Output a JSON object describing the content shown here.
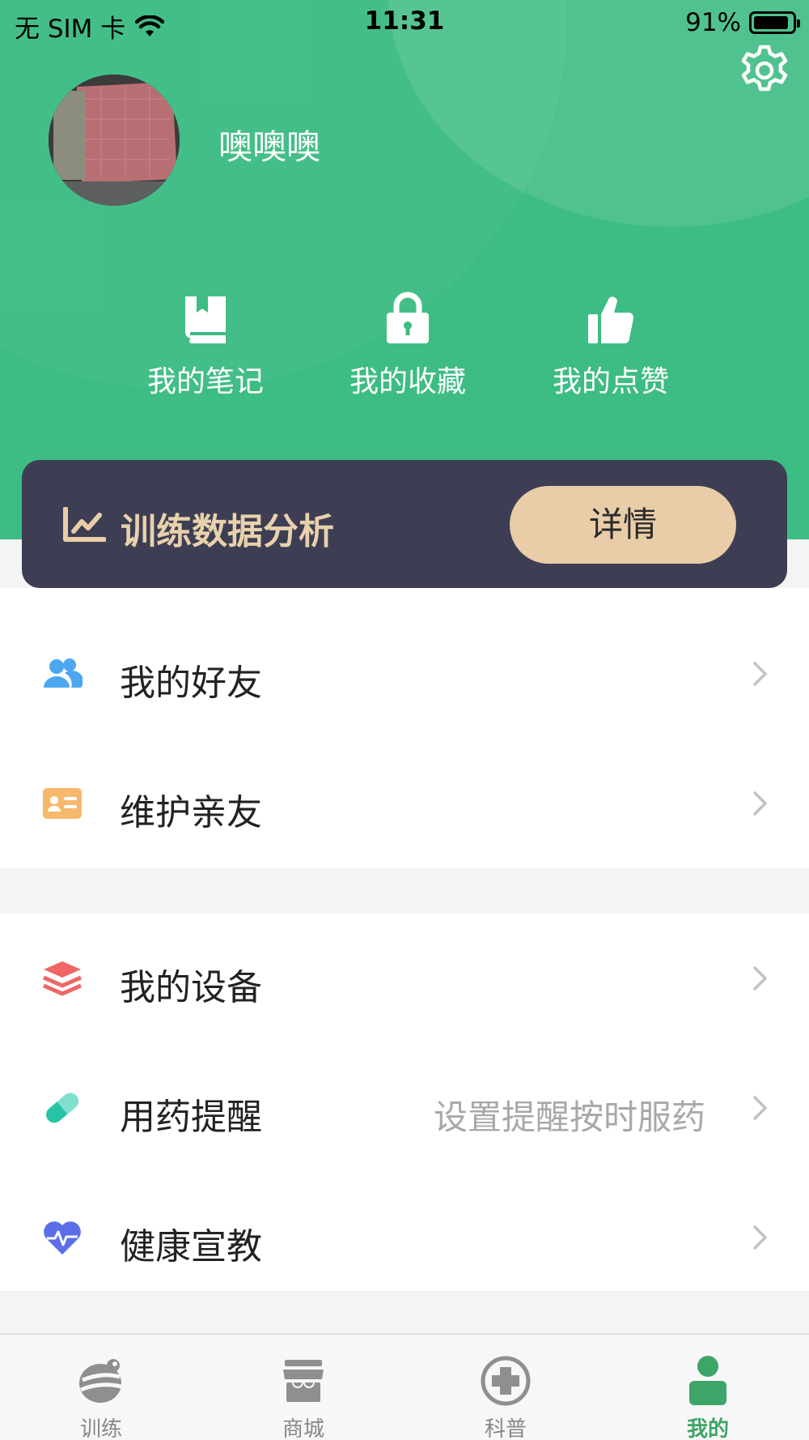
{
  "status_bar": {
    "carrier": "无 SIM 卡",
    "time": "11:31",
    "battery_percent": "91%",
    "battery_level": 0.91
  },
  "profile": {
    "username": "噢噢噢"
  },
  "quick_actions": [
    {
      "label": "我的笔记",
      "icon": "book-icon"
    },
    {
      "label": "我的收藏",
      "icon": "lock-icon"
    },
    {
      "label": "我的点赞",
      "icon": "thumbs-up-icon"
    }
  ],
  "banner": {
    "title": "训练数据分析",
    "button_label": "详情",
    "icon": "line-chart-icon"
  },
  "menu_groups": [
    [
      {
        "label": "我的好友",
        "hint": "",
        "icon": "friends-icon",
        "icon_color": "#4da6f0"
      },
      {
        "label": "维护亲友",
        "hint": "",
        "icon": "contact-card-icon",
        "icon_color": "#f6b96b"
      }
    ],
    [
      {
        "label": "我的设备",
        "hint": "",
        "icon": "layers-icon",
        "icon_color": "#f06565"
      },
      {
        "label": "用药提醒",
        "hint": "设置提醒按时服药",
        "icon": "pill-icon",
        "icon_color": "#28c2a5"
      },
      {
        "label": "健康宣教",
        "hint": "",
        "icon": "heartbeat-icon",
        "icon_color": "#5b6ee8"
      }
    ]
  ],
  "tabs": [
    {
      "label": "训练",
      "icon": "training-icon",
      "active": false
    },
    {
      "label": "商城",
      "icon": "store-icon",
      "active": false
    },
    {
      "label": "科普",
      "icon": "medical-cross-icon",
      "active": false
    },
    {
      "label": "我的",
      "icon": "person-icon",
      "active": true
    }
  ],
  "colors": {
    "primary_green": "#3dbc84",
    "banner_bg": "#3d3e53",
    "banner_accent": "#e9cda8",
    "tab_active": "#3da567"
  }
}
